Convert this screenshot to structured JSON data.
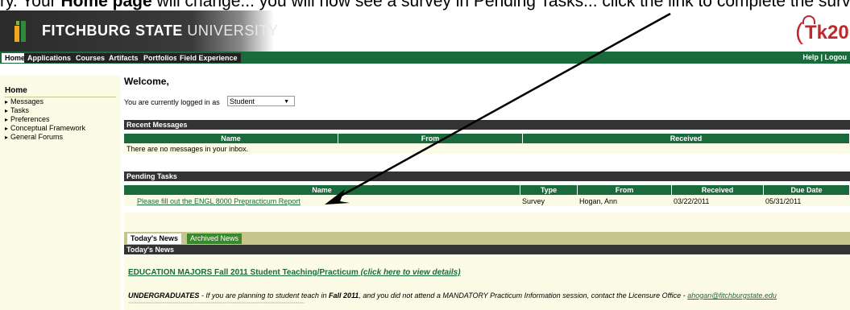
{
  "caption": {
    "part1": "ry. Your ",
    "bold": "Home page",
    "part2": " will change... you will now see a survey in Pending Tasks... click the link to complete the survey."
  },
  "header": {
    "brand_bold": "FITCHBURG STATE",
    "brand_rest": " UNIVERSITY",
    "tk_logo": "Tk20"
  },
  "nav": {
    "tabs": [
      "Home",
      "Applications",
      "Courses",
      "Artifacts",
      "Portfolios",
      "Field Experience"
    ],
    "help": "Help",
    "sep": "|",
    "logout": "Logou"
  },
  "sidebar": {
    "title": "Home",
    "items": [
      "Messages",
      "Tasks",
      "Preferences",
      "Conceptual Framework",
      "General Forums"
    ]
  },
  "main": {
    "welcome": "Welcome,",
    "logged_in_label": "You are currently logged in as",
    "role_select": "Student",
    "recent_messages": {
      "title": "Recent Messages",
      "columns": [
        "Name",
        "From",
        "Received"
      ],
      "empty": "There are no messages in your inbox."
    },
    "pending_tasks": {
      "title": "Pending Tasks",
      "columns": [
        "Name",
        "Type",
        "From",
        "Received",
        "Due Date"
      ],
      "rows": [
        {
          "name": "Please fill out the ENGL 8000 Prepracticum Report",
          "type": "Survey",
          "from": "Hogan, Ann",
          "received": "03/22/2011",
          "due": "05/31/2011"
        }
      ]
    },
    "news": {
      "tab_active": "Today's News",
      "tab_inactive": "Archived News",
      "section_title": "Today's News",
      "headline": "EDUCATION MAJORS Fall 2011 Student Teaching/Practicum",
      "headline_link": "(click here to view details)",
      "body_lead": "UNDERGRADUATES",
      "body_mid1": " - If you are planning to student teach in ",
      "body_term": "Fall 2011",
      "body_mid2": ", and you did not attend a MANDATORY Practicum Information session, contact the Licensure Office - ",
      "body_email": "ahogan@fitchburgstate.edu",
      "separator": "~~~~~~~~~~~~~~~~~~~~~~~~~~~~~~~~~~~~~~~~~~~~~~~~~~~~~~~~~~~~~~~~~~~~~~~~~~~~~~~~~~~~~~~"
    }
  },
  "colors": {
    "brand_green": "#1a6b3c",
    "header_dark": "#333333",
    "row_bg": "#fbfbe6",
    "tk_red": "#c0282e",
    "arrow": "#000000"
  }
}
